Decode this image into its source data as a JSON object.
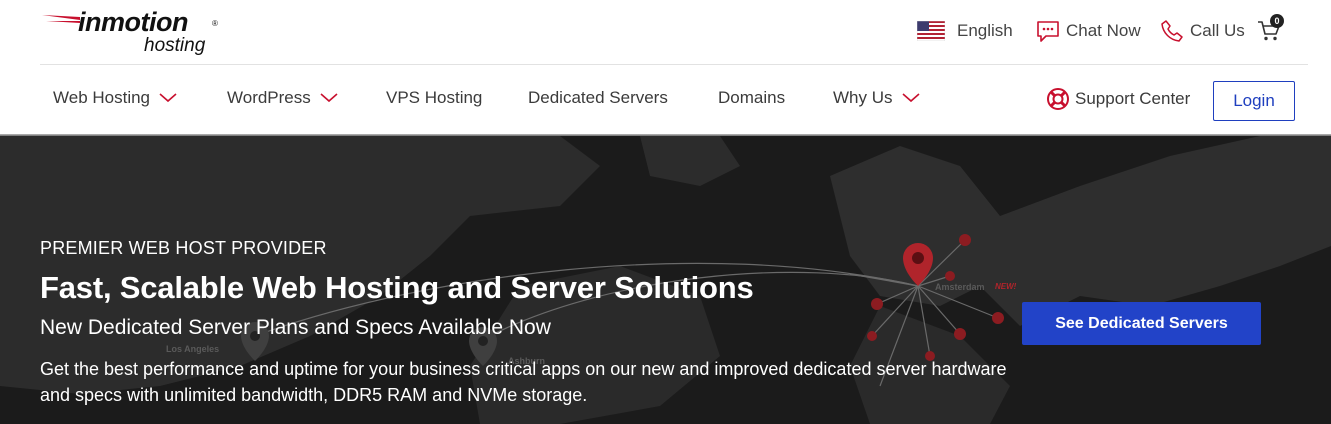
{
  "brand": {
    "name": "inmotion",
    "sub": "hosting",
    "reg": "®",
    "accent_color": "#c8102e"
  },
  "utility": {
    "language": "English",
    "chat": "Chat Now",
    "call": "Call Us",
    "cart_count": "0"
  },
  "nav": {
    "items": [
      {
        "label": "Web Hosting",
        "has_dropdown": true
      },
      {
        "label": "WordPress",
        "has_dropdown": true
      },
      {
        "label": "VPS Hosting",
        "has_dropdown": false
      },
      {
        "label": "Dedicated Servers",
        "has_dropdown": false
      },
      {
        "label": "Domains",
        "has_dropdown": false
      },
      {
        "label": "Why Us",
        "has_dropdown": true
      }
    ],
    "support": "Support Center",
    "login": "Login"
  },
  "hero": {
    "eyebrow": "PREMIER WEB HOST PROVIDER",
    "headline": "Fast, Scalable Web Hosting and Server Solutions",
    "subhead": "New Dedicated Server Plans and Specs Available Now",
    "body": "Get the best performance and uptime for your business critical apps on our new and improved dedicated server hardware and specs with unlimited bandwidth, DDR5 RAM and NVMe storage.",
    "cta": "See Dedicated Servers",
    "map_labels": {
      "los_angeles": "Los Angeles",
      "ashburn": "Ashburn",
      "amsterdam": "Amsterdam",
      "new_tag": "NEW!"
    },
    "colors": {
      "background": "#1b1b1b",
      "cta": "#2243c8",
      "pin": "#b0242b"
    }
  }
}
